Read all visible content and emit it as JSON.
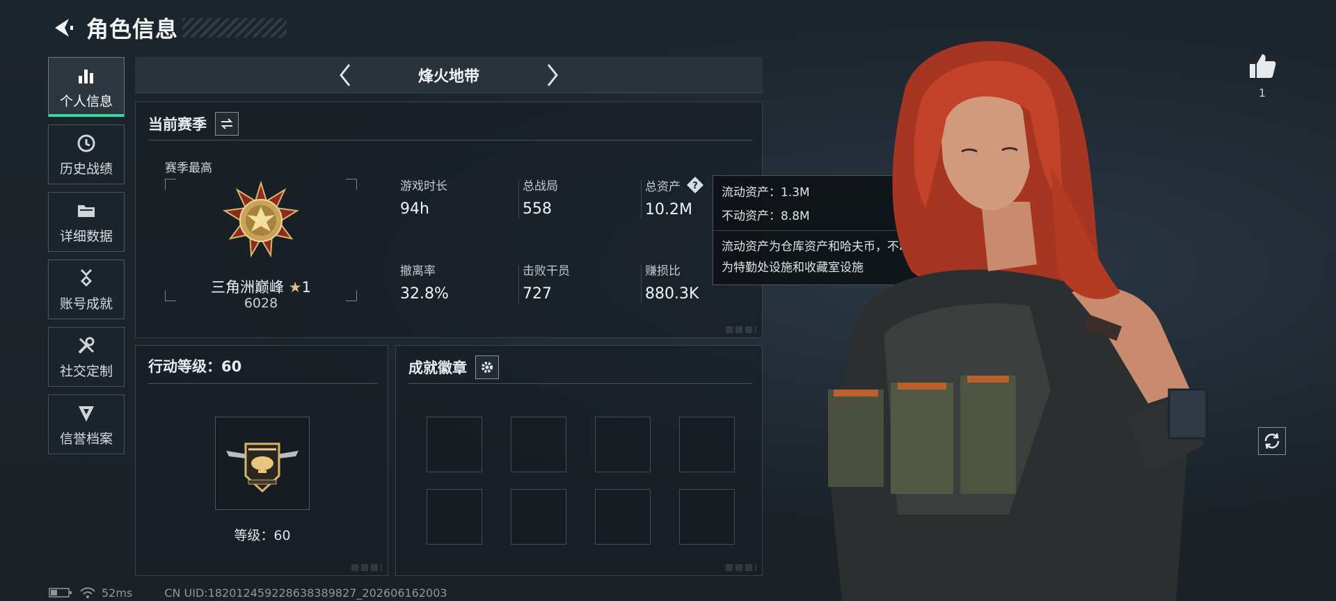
{
  "header": {
    "title": "角色信息"
  },
  "sidebar": {
    "items": [
      {
        "label": "个人信息",
        "icon": "bar-chart-icon",
        "active": true
      },
      {
        "label": "历史战绩",
        "icon": "history-clock-icon"
      },
      {
        "label": "详细数据",
        "icon": "folder-icon"
      },
      {
        "label": "账号成就",
        "icon": "medal-icon"
      },
      {
        "label": "社交定制",
        "icon": "wrench-icon"
      },
      {
        "label": "信誉档案",
        "icon": "shield-icon"
      }
    ]
  },
  "season_bar": {
    "name": "烽火地带"
  },
  "season_panel": {
    "title": "当前赛季",
    "season_high_label": "赛季最高",
    "rank_name": "三角洲巅峰",
    "rank_star": "★",
    "rank_stars": "1",
    "rank_score": "6028",
    "stats": [
      {
        "label": "游戏时长",
        "value": "94h"
      },
      {
        "label": "总战局",
        "value": "558"
      },
      {
        "label": "总资产",
        "value": "10.2M"
      },
      {
        "label": "撤离率",
        "value": "32.8%"
      },
      {
        "label": "击败干员",
        "value": "727"
      },
      {
        "label": "赚损比",
        "value": "880.3K"
      }
    ]
  },
  "tooltip": {
    "liquid": "流动资产：1.3M",
    "fixed": "不动资产：8.8M",
    "desc_line1": "流动资产为仓库资产和哈夫币，不动资产",
    "desc_line2": "为特勤处设施和收藏室设施"
  },
  "level_panel": {
    "title": "行动等级：60",
    "level_text": "等级：60"
  },
  "achievement_panel": {
    "title": "成就徽章",
    "slot_count": 8
  },
  "likes": {
    "count": "1"
  },
  "status_bar": {
    "ping": "52ms",
    "uid": "CN UID:18201245922863838982​7_202606162003"
  },
  "colors": {
    "accent": "#3fd6a1",
    "background": "#1b2229",
    "gold": "#d9c27a",
    "hair": "#b0371f"
  }
}
